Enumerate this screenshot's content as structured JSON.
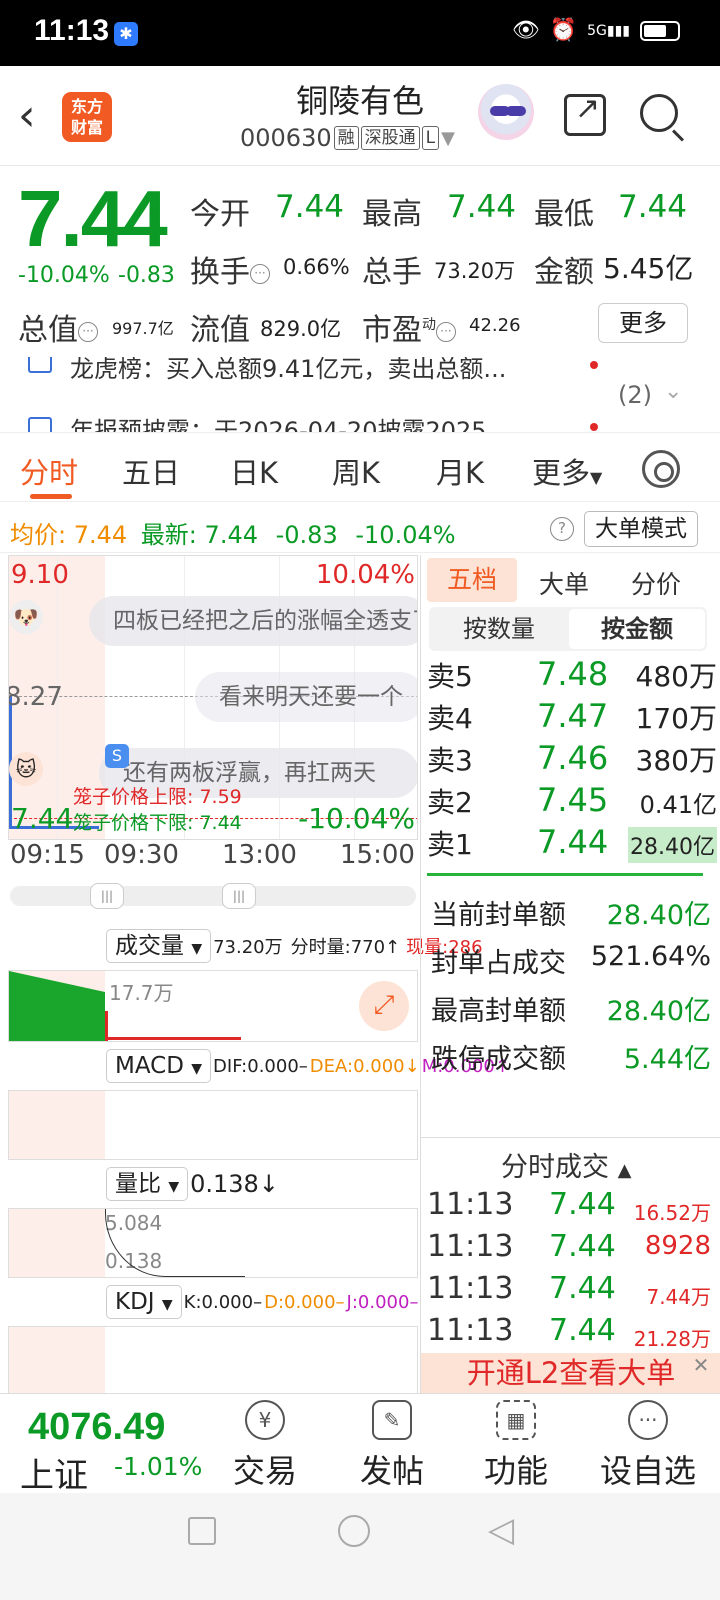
{
  "status": {
    "time": "11:13",
    "app_badge": "✱",
    "net": "5G"
  },
  "header": {
    "logo_line1": "东方",
    "logo_line2": "财富",
    "name": "铜陵有色",
    "code": "000630",
    "tag1": "融",
    "tag2": "深股通",
    "tag3": "L"
  },
  "quote": {
    "price": "7.44",
    "pct": "-10.04%",
    "chg": "-0.83",
    "open_label": "今开",
    "open": "7.44",
    "high_label": "最高",
    "high": "7.44",
    "low_label": "最低",
    "low": "7.44",
    "turnover_label": "换手",
    "turnover": "0.66%",
    "vol_label": "总手",
    "vol": "73.20万",
    "amount_label": "金额",
    "amount": "5.45亿",
    "mktcap_label": "总值",
    "mktcap": "997.7亿",
    "float_label": "流值",
    "float": "829.0亿",
    "pe_label": "市盈",
    "pe_sup": "动",
    "pe": "42.26",
    "more": "更多"
  },
  "news": {
    "line1": "龙虎榜：买入总额9.41亿元，卖出总额...",
    "line2": "年报预披露：于2026-04-20披露2025",
    "count": "(2)"
  },
  "tabs": {
    "t1": "分时",
    "t2": "五日",
    "t3": "日K",
    "t4": "周K",
    "t5": "月K",
    "t6": "更多"
  },
  "avgline": {
    "avg_label": "均价:",
    "avg": "7.44",
    "latest_label": "最新:",
    "latest": "7.44",
    "chg": "-0.83",
    "pct": "-10.04%",
    "mode_btn": "大单模式"
  },
  "chart": {
    "top_price": "9.10",
    "top_pct": "10.04%",
    "mid_price": "8.27",
    "bottom_price": "7.44",
    "bottom_pct": "-10.04%",
    "upper_limit_label": "笼子价格上限:",
    "upper_limit": "7.59",
    "lower_limit_label": "笼子价格下限:",
    "lower_limit": "7.44",
    "comment1": "四板已经把之后的涨幅全透支了",
    "comment2": "看来明天还要一个",
    "comment3": "还有两板浮赢，再扛两天",
    "t1": "09:15",
    "t2": "09:30",
    "t3": "13:00",
    "t4": "15:00"
  },
  "vol": {
    "label": "成交量",
    "total": "73.20万",
    "ftl": "分时量:770↑",
    "cur": "现量:286",
    "max": "17.7万"
  },
  "macd": {
    "label": "MACD",
    "dif": "DIF:0.000–",
    "dea": "DEA:0.000↓",
    "m": "M:0.000↑"
  },
  "lb": {
    "label": "量比",
    "val": "0.138↓",
    "max": "5.084",
    "min": "0.138"
  },
  "kdj": {
    "label": "KDJ",
    "k": "K:0.000–",
    "d": "D:0.000–",
    "j": "J:0.000–"
  },
  "rpanel": {
    "tab1": "五档",
    "tab2": "大单",
    "tab3": "分价",
    "seg1": "按数量",
    "seg2": "按金额",
    "orders": [
      {
        "l": "卖5",
        "p": "7.48",
        "a": "480万"
      },
      {
        "l": "卖4",
        "p": "7.47",
        "a": "170万"
      },
      {
        "l": "卖3",
        "p": "7.46",
        "a": "380万"
      },
      {
        "l": "卖2",
        "p": "7.45",
        "a": "0.41亿"
      },
      {
        "l": "卖1",
        "p": "7.44",
        "a": "28.40亿"
      }
    ],
    "stats": [
      {
        "k": "当前封单额",
        "v": "28.40亿"
      },
      {
        "k": "封单占成交",
        "v": "521.64%"
      },
      {
        "k": "最高封单额",
        "v": "28.40亿"
      },
      {
        "k": "跌停成交额",
        "v": "5.44亿"
      }
    ],
    "ticks_title": "分时成交",
    "ticks": [
      {
        "t": "11:13",
        "p": "7.44",
        "a": "16.52万"
      },
      {
        "t": "11:13",
        "p": "7.44",
        "a": "8928"
      },
      {
        "t": "11:13",
        "p": "7.44",
        "a": "7.44万"
      },
      {
        "t": "11:13",
        "p": "7.44",
        "a": "21.28万"
      }
    ],
    "l2": "开通L2查看大单"
  },
  "bottom": {
    "idx_val": "4076.49",
    "idx_name": "上证",
    "idx_pct": "-1.01%",
    "nav1": "交易",
    "nav2": "发帖",
    "nav3": "功能",
    "nav4": "设自选"
  },
  "colors": {
    "up": "#e02828",
    "down": "#0a9a25",
    "accent": "#f15a22"
  }
}
